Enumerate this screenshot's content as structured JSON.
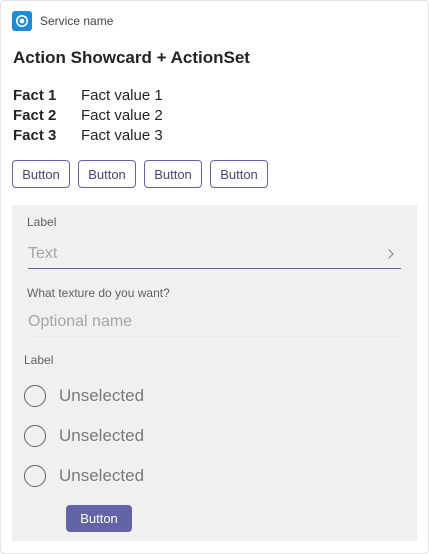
{
  "header": {
    "service_name": "Service name",
    "icon": "service-logo-icon",
    "icon_color": "#1f8ad6"
  },
  "card": {
    "title": "Action Showcard + ActionSet",
    "facts": [
      {
        "title": "Fact 1",
        "value": "Fact value 1"
      },
      {
        "title": "Fact 2",
        "value": "Fact value 2"
      },
      {
        "title": "Fact 3",
        "value": "Fact value 3"
      }
    ],
    "actions": [
      "Button",
      "Button",
      "Button",
      "Button"
    ]
  },
  "showcard": {
    "text_input": {
      "label": "Label",
      "placeholder": "Text",
      "icon": "chevron-right-icon"
    },
    "name_input": {
      "label": "What texture do you want?",
      "placeholder": "Optional name"
    },
    "choice_set": {
      "label": "Label",
      "options": [
        "Unselected",
        "Unselected",
        "Unselected"
      ]
    },
    "submit_label": "Button"
  },
  "colors": {
    "accent": "#6264a7",
    "showcard_background": "#f0f0f0"
  }
}
